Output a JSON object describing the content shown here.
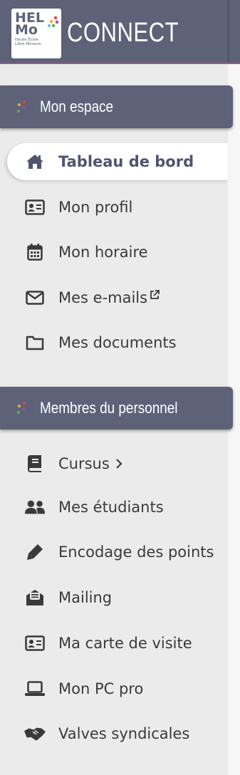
{
  "header": {
    "logo": {
      "line1": "HEL",
      "line2": "Mo",
      "subtitle_1": "Haute École",
      "subtitle_2": "Libre Mosane"
    },
    "app_title": "CONNECT"
  },
  "colors": {
    "header_bg": "#5d6278",
    "header_border": "#a0549b",
    "sidebar_bg": "#ebebeb",
    "active_bg": "#ffffff",
    "active_text": "#4f5470",
    "text": "#3a3a3a",
    "dot_red": "#e5413d",
    "dot_green": "#5bb44a",
    "dot_orange": "#f2a72a",
    "dot_purple": "#9a4fa1",
    "dot_blue": "#3fa7d6"
  },
  "sections": [
    {
      "title": "Mon espace",
      "items": [
        {
          "label": "Tableau de bord",
          "icon": "home-icon",
          "active": true
        },
        {
          "label": "Mon profil",
          "icon": "id-card-icon"
        },
        {
          "label": "Mon horaire",
          "icon": "calendar-icon"
        },
        {
          "label": "Mes e-mails",
          "icon": "envelope-icon",
          "external": true
        },
        {
          "label": "Mes documents",
          "icon": "folder-icon"
        }
      ]
    },
    {
      "title": "Membres du personnel",
      "items": [
        {
          "label": "Cursus",
          "icon": "book-icon",
          "submenu": true
        },
        {
          "label": "Mes étudiants",
          "icon": "users-icon"
        },
        {
          "label": "Encodage des points",
          "icon": "pen-icon"
        },
        {
          "label": "Mailing",
          "icon": "envelope-open-icon"
        },
        {
          "label": "Ma carte de visite",
          "icon": "address-card-icon"
        },
        {
          "label": "Mon PC pro",
          "icon": "laptop-icon"
        },
        {
          "label": "Valves syndicales",
          "icon": "handshake-icon"
        }
      ]
    }
  ]
}
